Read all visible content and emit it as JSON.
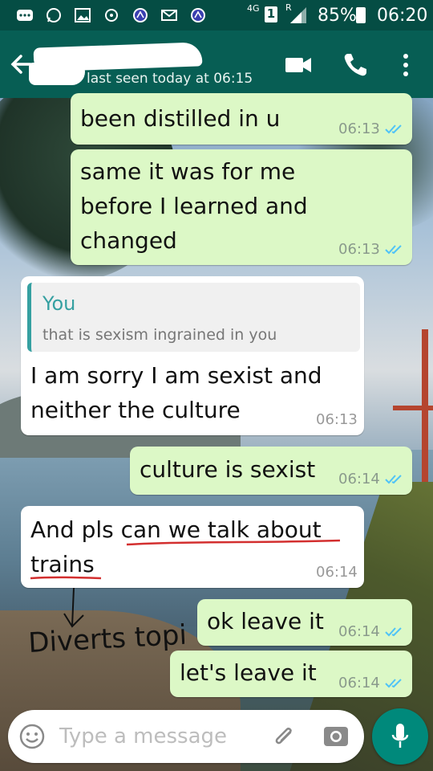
{
  "status_bar": {
    "network": "4G",
    "sim": "1",
    "roaming": "R",
    "battery": "85%",
    "time": "06:20",
    "icons": [
      "more-icon",
      "whatsapp-icon",
      "gallery-icon",
      "data-saver-icon",
      "messenger-icon",
      "mail-icon",
      "messenger-icon"
    ]
  },
  "header": {
    "contact_name": "",
    "last_seen": "last seen today at 06:15",
    "icons": [
      "back-arrow-icon",
      "video-call-icon",
      "phone-icon",
      "more-vert-icon"
    ]
  },
  "messages": [
    {
      "direction": "out",
      "text": "been distilled in u",
      "time": "06:13",
      "ticks": "read"
    },
    {
      "direction": "out",
      "text": "same it was for me\nbefore I learned and\nchanged",
      "time": "06:13",
      "ticks": "read"
    },
    {
      "direction": "in",
      "quote_author": "You",
      "quote_text": "that is sexism ingrained in you",
      "text": "I am sorry I am sexist and\nneither the culture",
      "time": "06:13"
    },
    {
      "direction": "out",
      "text": "culture is sexist",
      "time": "06:14",
      "ticks": "read"
    },
    {
      "direction": "in",
      "text": "And pls can we talk about\ntrains",
      "underlined": "can we talk about trains",
      "time": "06:14"
    },
    {
      "direction": "out",
      "text": "ok leave it",
      "time": "06:14",
      "ticks": "read"
    },
    {
      "direction": "out",
      "text": "let's leave it",
      "time": "06:14",
      "ticks": "read"
    }
  ],
  "annotation": {
    "text": "Diverts topic"
  },
  "composer": {
    "placeholder": "Type a message",
    "icons": [
      "emoji-icon",
      "attach-icon",
      "camera-icon",
      "mic-icon"
    ]
  },
  "colors": {
    "status_bar": "#054d44",
    "header": "#075e54",
    "outgoing_bubble": "#dcf8c6",
    "incoming_bubble": "#ffffff",
    "read_ticks": "#4fc3f7",
    "quote_accent": "#35a0a1",
    "annotation_underline": "#d32f2f",
    "mic_button": "#00897b"
  }
}
